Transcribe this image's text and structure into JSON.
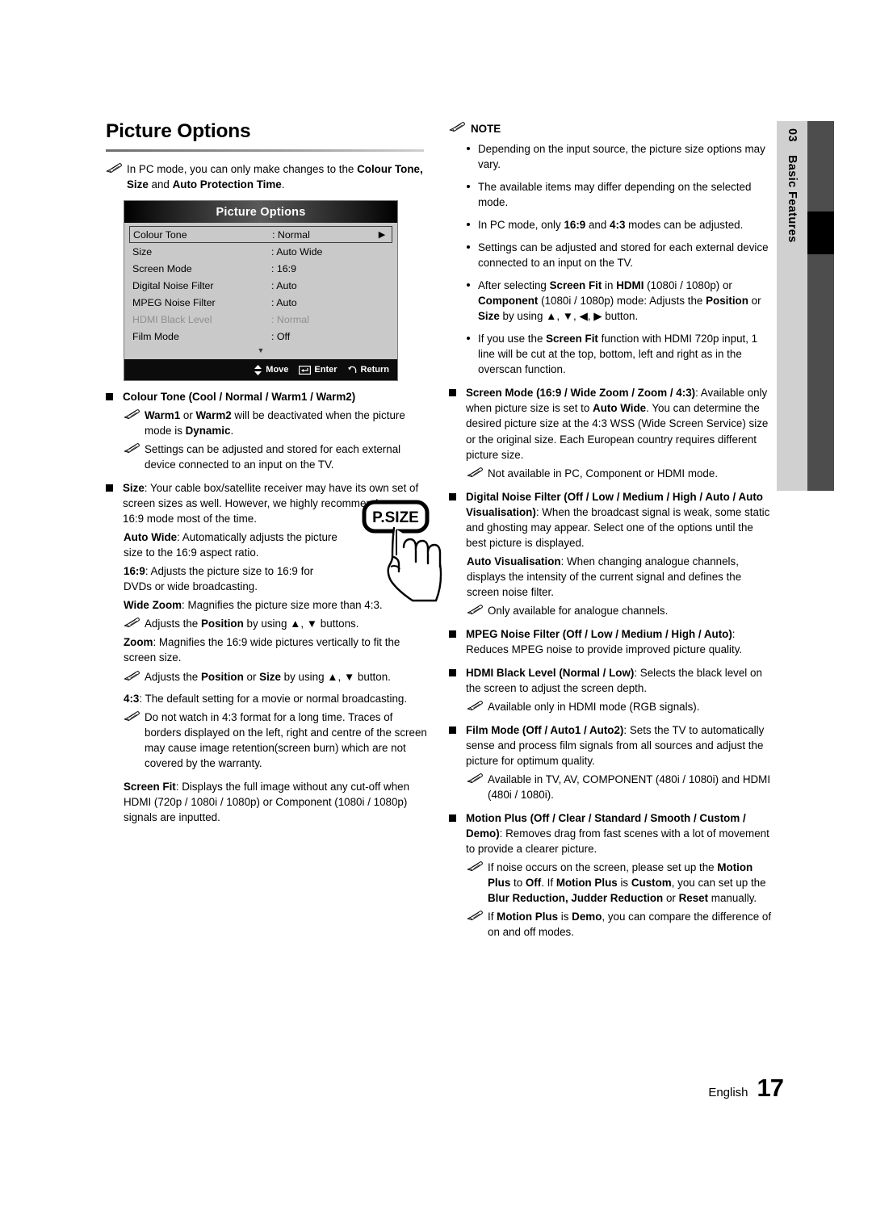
{
  "page": {
    "title": "Picture Options",
    "footer_language": "English",
    "footer_page_number": "17"
  },
  "side_tab": {
    "chapter_number": "03",
    "chapter_label": "Basic Features"
  },
  "left_column": {
    "intro_note": "In PC mode, you can only make changes to the Colour Tone, Size and Auto Protection Time.",
    "intro_note_plain": "In PC mode, you can only make changes to the ",
    "intro_note_bold1": "Colour Tone, Size",
    "intro_note_mid": " and ",
    "intro_note_bold2": "Auto Protection Time",
    "intro_note_end": ".",
    "osd": {
      "title": "Picture Options",
      "rows": [
        {
          "label": "Colour Tone",
          "value": ": Normal",
          "selected": true,
          "dim": false,
          "arrow": "▶"
        },
        {
          "label": "Size",
          "value": ": Auto Wide",
          "selected": false,
          "dim": false,
          "arrow": ""
        },
        {
          "label": "Screen Mode",
          "value": ": 16:9",
          "selected": false,
          "dim": false,
          "arrow": ""
        },
        {
          "label": "Digital Noise Filter",
          "value": ": Auto",
          "selected": false,
          "dim": false,
          "arrow": ""
        },
        {
          "label": "MPEG Noise Filter",
          "value": ": Auto",
          "selected": false,
          "dim": false,
          "arrow": ""
        },
        {
          "label": "HDMI Black Level",
          "value": ": Normal",
          "selected": false,
          "dim": true,
          "arrow": ""
        },
        {
          "label": "Film Mode",
          "value": ": Off",
          "selected": false,
          "dim": false,
          "arrow": ""
        }
      ],
      "scroll_indicator": "▼",
      "footer_move": "Move",
      "footer_enter": "Enter",
      "footer_return": "Return"
    },
    "colour_tone_heading": "Colour Tone (Cool / Normal / Warm1 / Warm2)",
    "colour_tone_note1_a": "Warm1",
    "colour_tone_note1_b": " or ",
    "colour_tone_note1_c": "Warm2",
    "colour_tone_note1_d": " will be deactivated when the picture mode is ",
    "colour_tone_note1_e": "Dynamic",
    "colour_tone_note1_f": ".",
    "colour_tone_note2": "Settings can be adjusted and stored for each external device connected to an input on the TV.",
    "size_heading_bold": "Size",
    "size_heading_rest": ": Your cable box/satellite receiver may have its own set of screen sizes as well. However, we highly recommend you use 16:9 mode most of the time.",
    "psize_button_label": "P.SIZE",
    "auto_wide_bold": "Auto Wide",
    "auto_wide_rest": ": Automatically adjusts the picture size to the 16:9 aspect ratio.",
    "ratio169_bold": "16:9",
    "ratio169_rest": ": Adjusts the picture size to 16:9 for DVDs or wide broadcasting.",
    "wide_zoom_bold": "Wide Zoom",
    "wide_zoom_rest": ": Magnifies the picture size more than 4:3.",
    "wide_zoom_note_a": "Adjusts the ",
    "wide_zoom_note_b": "Position",
    "wide_zoom_note_c": " by using ▲, ▼ buttons.",
    "zoom_bold": "Zoom",
    "zoom_rest": ": Magnifies the 16:9 wide pictures vertically to fit the screen size.",
    "zoom_note_a": "Adjusts the ",
    "zoom_note_b": "Position",
    "zoom_note_c": " or ",
    "zoom_note_d": "Size",
    "zoom_note_e": " by using ▲, ▼ button.",
    "ratio43_bold": "4:3",
    "ratio43_rest": ": The default setting for a movie or normal broadcasting.",
    "ratio43_note": "Do not watch in 4:3 format for a long time. Traces of borders displayed on the left, right and centre of the screen may cause image retention(screen burn) which are not covered by the warranty.",
    "screen_fit_bold": "Screen Fit",
    "screen_fit_rest": ": Displays the full image without any cut-off when HDMI (720p / 1080i / 1080p) or Component (1080i / 1080p) signals are inputted."
  },
  "right_column": {
    "note_label": "NOTE",
    "note_items": [
      {
        "plain": "Depending on the input source, the picture size options may vary."
      },
      {
        "plain": "The available items may differ depending on the selected mode."
      },
      {
        "a": "In PC mode, only ",
        "b1": "16:9",
        "c": " and ",
        "b2": "4:3",
        "d": " modes can be adjusted."
      },
      {
        "plain": "Settings can be adjusted and stored for each external device connected to an input on the TV."
      },
      {
        "a": "After selecting ",
        "b1": "Screen Fit",
        "c": " in ",
        "b2": "HDMI",
        "d": " (1080i / 1080p) or ",
        "b3": "Component",
        "e": " (1080i / 1080p) mode: Adjusts the ",
        "b4": "Position",
        "f": " or ",
        "b5": "Size",
        "g": " by using ▲, ▼, ◀, ▶ button."
      },
      {
        "a": "If you use the ",
        "b1": "Screen Fit",
        "c": " function with HDMI 720p input, 1 line will be cut at the top, bottom, left and right as in the overscan function."
      }
    ],
    "screen_mode_bold": "Screen Mode (16:9 / Wide Zoom / Zoom / 4:3)",
    "screen_mode_rest_a": ": Available only when picture size is set to ",
    "screen_mode_rest_b": "Auto Wide",
    "screen_mode_rest_c": ". You can determine the desired picture size at the 4:3 WSS (Wide Screen Service) size or the original size. Each European country requires different picture size.",
    "screen_mode_note": "Not available in PC, Component or HDMI mode.",
    "dnf_bold": "Digital Noise Filter (Off / Low / Medium / High / Auto / Auto Visualisation)",
    "dnf_rest": ": When the broadcast signal is weak, some static and ghosting may appear. Select one of the options until the best picture is displayed.",
    "auto_vis_bold": "Auto Visualisation",
    "auto_vis_rest": ": When changing analogue channels, displays the intensity of the current signal and defines the screen noise filter.",
    "auto_vis_note": "Only available for analogue channels.",
    "mpeg_bold": "MPEG Noise Filter (Off / Low / Medium / High / Auto)",
    "mpeg_rest": ": Reduces MPEG noise to provide improved picture quality.",
    "hdmi_bold": "HDMI Black Level (Normal / Low)",
    "hdmi_rest": ": Selects the black level on the screen to adjust the screen depth.",
    "hdmi_note": "Available only in HDMI mode (RGB signals).",
    "film_bold": "Film Mode (Off / Auto1 / Auto2)",
    "film_rest": ": Sets the TV to automatically sense and process film signals from all sources and adjust the picture for optimum quality.",
    "film_note": "Available in TV, AV, COMPONENT (480i / 1080i) and HDMI (480i / 1080i).",
    "motion_bold": "Motion Plus (Off / Clear / Standard / Smooth / Custom / Demo)",
    "motion_rest": ": Removes drag from fast scenes with a lot of movement to provide a clearer picture.",
    "motion_note1_a": "If noise occurs on the screen, please set up the ",
    "motion_note1_b1": "Motion Plus",
    "motion_note1_c": " to ",
    "motion_note1_b2": "Off",
    "motion_note1_d": ". If ",
    "motion_note1_b3": "Motion Plus",
    "motion_note1_e": " is ",
    "motion_note1_b4": "Custom",
    "motion_note1_f": ", you can set up the ",
    "motion_note1_b5": "Blur Reduction, Judder Reduction",
    "motion_note1_g": " or ",
    "motion_note1_b6": "Reset",
    "motion_note1_h": " manually.",
    "motion_note2_a": "If ",
    "motion_note2_b1": "Motion Plus",
    "motion_note2_c": " is ",
    "motion_note2_b2": "Demo",
    "motion_note2_d": ", you can compare the difference of on and off modes."
  },
  "colors": {
    "osd_body": "#c9c9c9",
    "osd_footer": "#0c0c0c",
    "side_tab": "#d0d0d0",
    "side_bar": "#4d4d4d",
    "side_marker": "#000000"
  }
}
